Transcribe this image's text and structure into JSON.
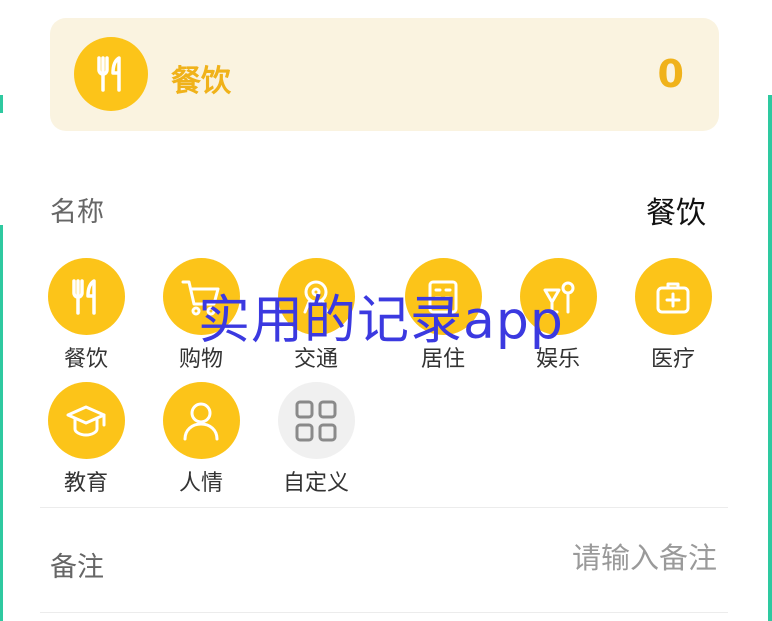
{
  "header": {
    "category": "餐饮",
    "amount": "0"
  },
  "name_row": {
    "label": "名称",
    "value": "餐饮"
  },
  "categories": [
    {
      "label": "餐饮",
      "icon": "utensils-icon"
    },
    {
      "label": "购物",
      "icon": "cart-icon"
    },
    {
      "label": "交通",
      "icon": "transport-icon"
    },
    {
      "label": "居住",
      "icon": "home-icon"
    },
    {
      "label": "娱乐",
      "icon": "entertainment-icon"
    },
    {
      "label": "医疗",
      "icon": "medical-kit-icon"
    },
    {
      "label": "教育",
      "icon": "graduation-cap-icon"
    },
    {
      "label": "人情",
      "icon": "person-icon"
    },
    {
      "label": "自定义",
      "icon": "grid-icon"
    }
  ],
  "notes": {
    "label": "备注",
    "placeholder": "请输入备注"
  },
  "watermark": "实用的记录app",
  "colors": {
    "accent": "#fcc419",
    "accent_text": "#f0b21a",
    "card_bg": "#faf3e0",
    "edge": "#2ec9a0"
  }
}
